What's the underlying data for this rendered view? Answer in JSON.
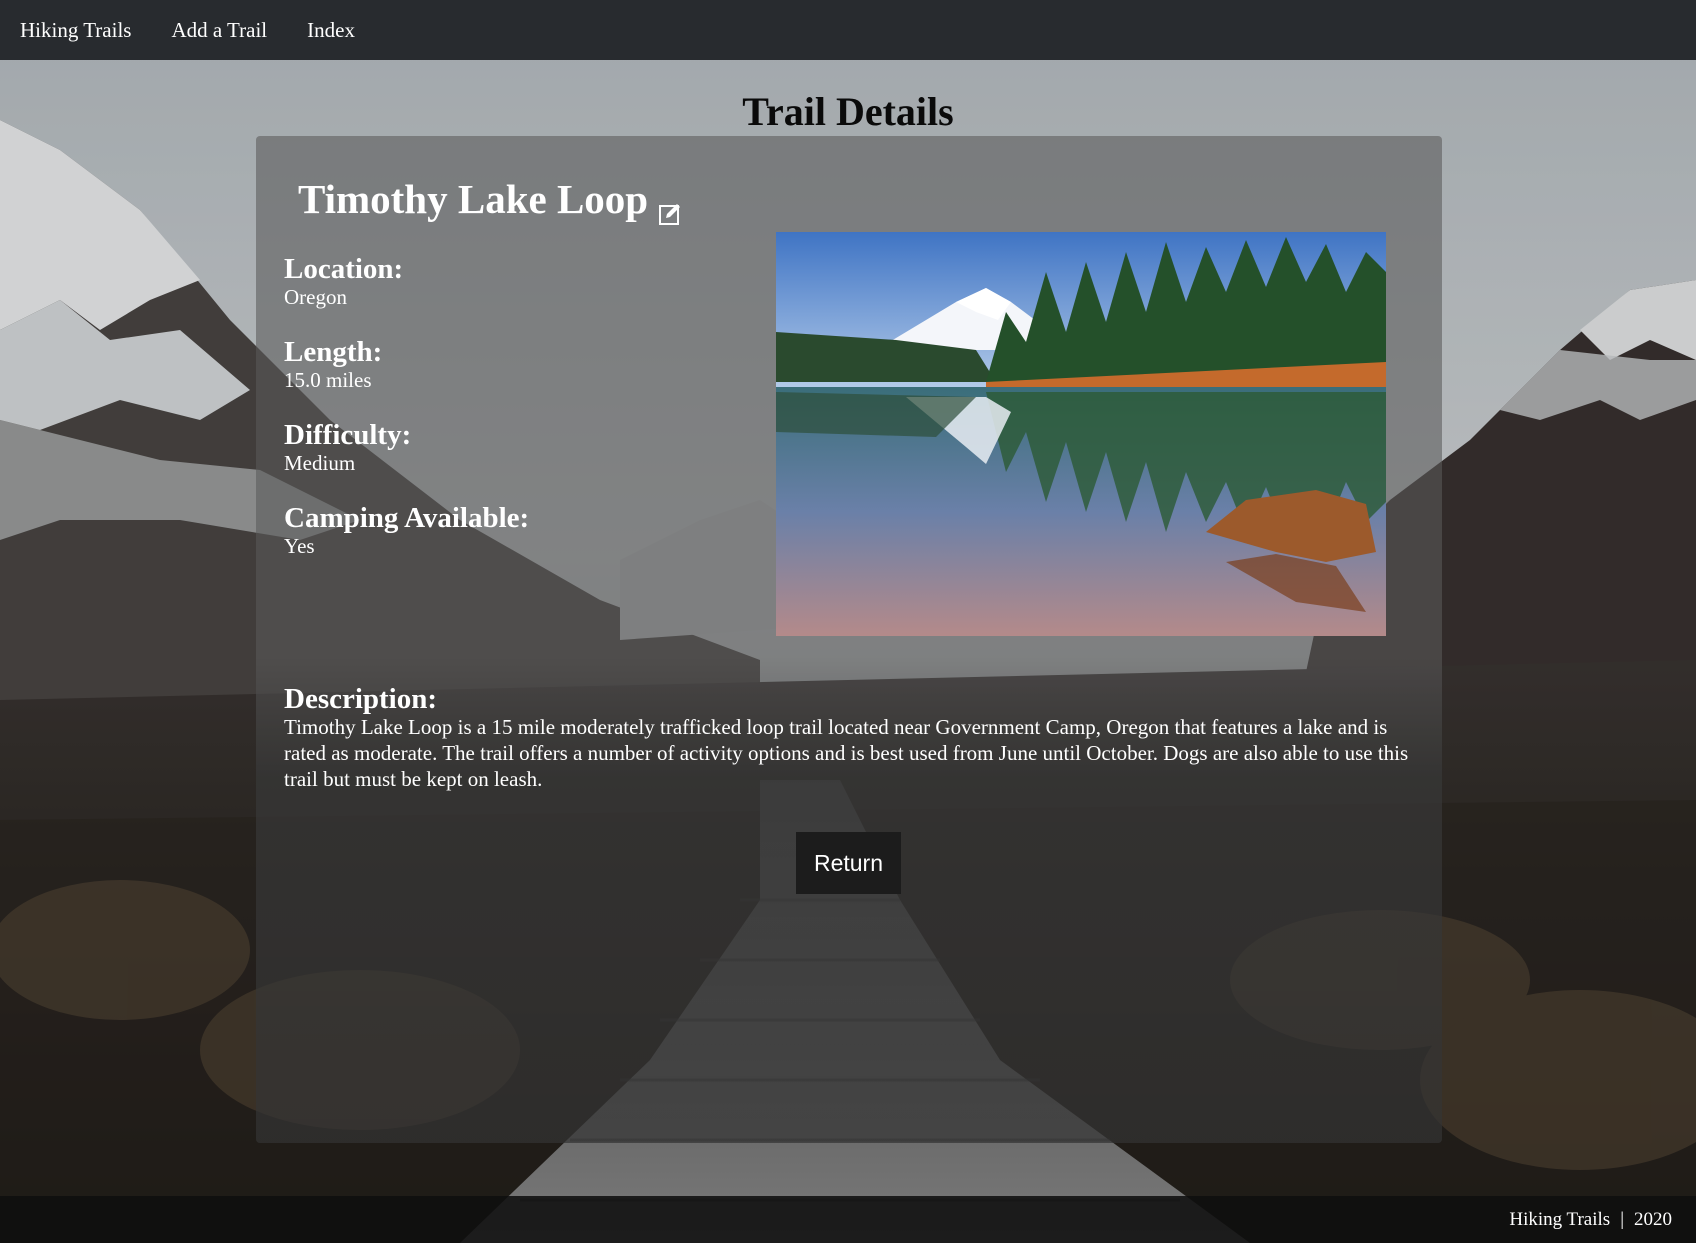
{
  "nav": {
    "home_label": "Hiking Trails",
    "add_label": "Add a Trail",
    "index_label": "Index"
  },
  "page": {
    "title": "Trail Details"
  },
  "trail": {
    "name": "Timothy Lake Loop",
    "location_label": "Location:",
    "location": "Oregon",
    "length_label": "Length:",
    "length": "15.0 miles",
    "difficulty_label": "Difficulty:",
    "difficulty": "Medium",
    "camping_label": "Camping Available:",
    "camping": "Yes",
    "description_label": "Description:",
    "description": "Timothy Lake Loop is a 15 mile moderately trafficked loop trail located near Government Camp, Oregon that features a lake and is rated as moderate. The trail offers a number of activity options and is best used from June until October. Dogs are also able to use this trail but must be kept on leash."
  },
  "actions": {
    "return_label": "Return"
  },
  "footer": {
    "brand": "Hiking Trails",
    "separator": "|",
    "year": "2020"
  },
  "icons": {
    "edit": "edit-icon"
  },
  "colors": {
    "navbar": "#282b2f",
    "button": "#1c1c1c",
    "title": "#0a0a0a"
  }
}
